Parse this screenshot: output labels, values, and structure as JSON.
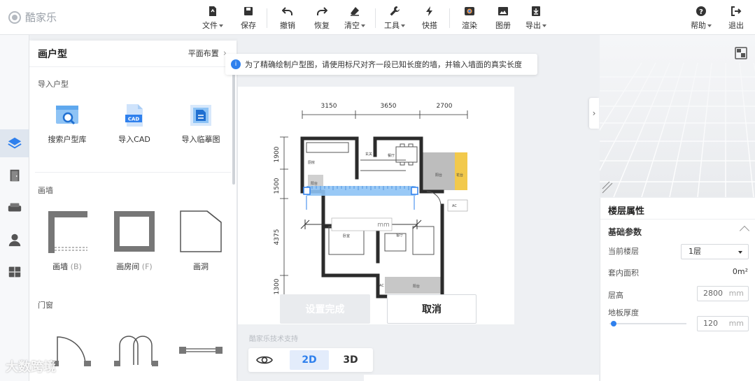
{
  "app": {
    "logo_text": "酷家乐"
  },
  "toolbar": {
    "items": [
      {
        "label": "文件",
        "icon": "file-icon"
      },
      {
        "label": "保存",
        "icon": "save-icon"
      },
      {
        "label": "撤销",
        "icon": "undo-icon"
      },
      {
        "label": "恢复",
        "icon": "redo-icon"
      },
      {
        "label": "清空",
        "icon": "eraser-icon"
      },
      {
        "label": "工具",
        "icon": "wrench-icon"
      },
      {
        "label": "快搭",
        "icon": "lightning-icon"
      },
      {
        "label": "渲染",
        "icon": "render-icon"
      },
      {
        "label": "图册",
        "icon": "album-icon"
      },
      {
        "label": "导出",
        "icon": "export-icon"
      },
      {
        "label": "帮助",
        "icon": "help-icon"
      },
      {
        "label": "退出",
        "icon": "exit-icon"
      }
    ]
  },
  "panel": {
    "title": "画户型",
    "link": "平面布置",
    "import_section": "导入户型",
    "import_items": [
      "搜索户型库",
      "导入CAD",
      "导入临摹图"
    ],
    "cad_badge": "CAD",
    "wall_section": "画墙",
    "wall_items": [
      {
        "label": "画墙",
        "shortcut": "(B)"
      },
      {
        "label": "画房间",
        "shortcut": "(F)"
      },
      {
        "label": "画洞",
        "shortcut": ""
      }
    ],
    "door_section": "门窗"
  },
  "canvas": {
    "hint": "为了精确绘制户型图，请使用标尺对齐一段已知长度的墙，并输入墙面的真实长度",
    "dims_top": [
      "3150",
      "3650",
      "2700"
    ],
    "dims_left": [
      "1900",
      "1500",
      "4375",
      "1300"
    ],
    "ruler_unit": "mm",
    "confirm_label": "设置完成",
    "cancel_label": "取消",
    "support_text": "酷家乐技术支持",
    "view_2d": "2D",
    "view_3d": "3D"
  },
  "props": {
    "title": "楼层属性",
    "group": "基础参数",
    "current_floor_label": "当前楼层",
    "current_floor_value": "1层",
    "area_label": "套内面积",
    "area_value": "0m²",
    "height_label": "层高",
    "height_value": "2800",
    "slab_label": "地板厚度",
    "slab_value": "120",
    "unit": "mm",
    "slab_fraction": 0.05
  },
  "watermark": "大数跨境",
  "colors": {
    "accent": "#2f80ed",
    "wall": "#333333",
    "balcony": "#f2c94c"
  }
}
